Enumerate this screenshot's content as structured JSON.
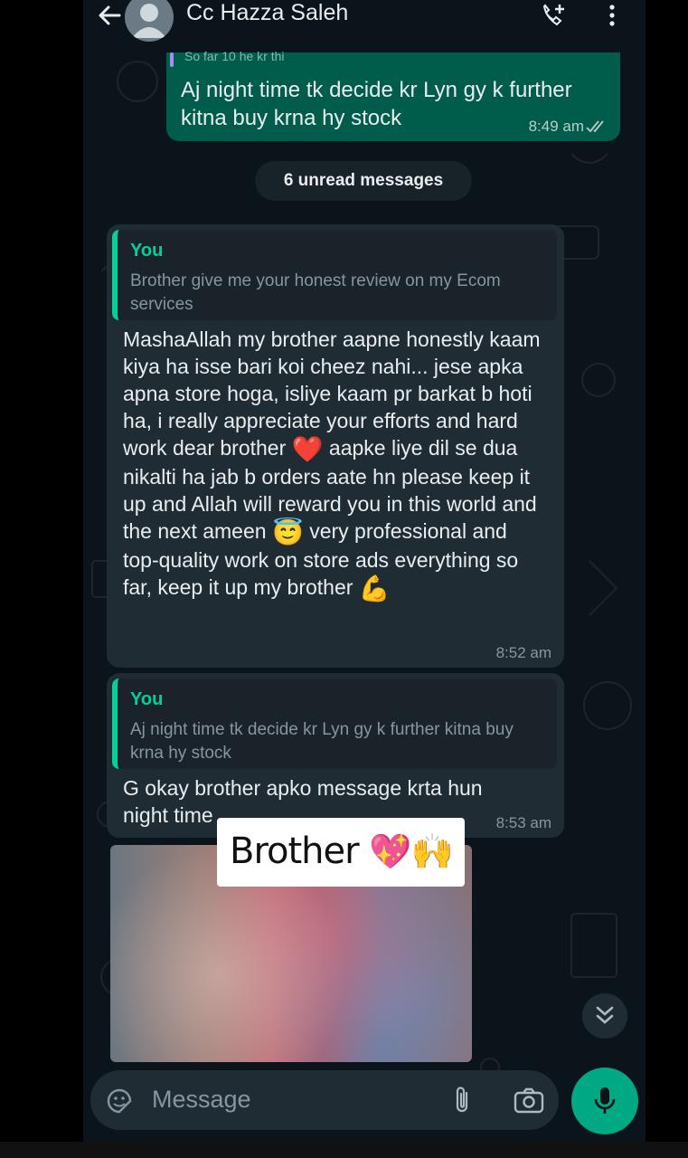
{
  "header": {
    "contact_name": "Cc Hazza Saleh"
  },
  "outgoing_message": {
    "quote_peek": "So far 10 he kr thi",
    "text": "Aj night time tk decide kr Lyn gy k further kitna buy krna hy stock",
    "time": "8:49 am",
    "status": "read"
  },
  "unread_banner": "6 unread messages",
  "incoming_messages": [
    {
      "quote_author": "You",
      "quote_text": "Brother give me your honest review on my Ecom services",
      "text_parts": [
        "MashaAllah my brother aapne honestly kaam kiya ha isse bari koi cheez nahi... jese apka apna store hoga, isliye kaam pr barkat b hoti ha, i really appreciate your efforts and hard work dear brother",
        "aapke liye dil se dua nikalti ha jab b orders aate hn please keep it up and Allah will reward you in this world and the next ameen",
        "very professional and top-quality work on store ads everything so far, keep it up my brother"
      ],
      "emojis": [
        "❤️",
        "😇",
        "💪"
      ],
      "time": "8:52 am"
    },
    {
      "quote_author": "You",
      "quote_text": "Aj night time tk decide kr Lyn gy k further kitna buy krna hy stock",
      "text": "G okay brother apko message krta hun night time",
      "time": "8:53 am"
    }
  ],
  "sticker_overlay": {
    "text": "Brother",
    "emojis": "💖🙌"
  },
  "input": {
    "placeholder": "Message"
  },
  "icons": {
    "back": "arrow-left-icon",
    "call": "add-call-icon",
    "menu": "more-vertical-icon",
    "sticker": "sticker-icon",
    "attach": "paperclip-icon",
    "camera": "camera-icon",
    "mic": "microphone-icon",
    "scroll": "double-chevron-down-icon"
  },
  "colors": {
    "outgoing_bubble": "#005c4b",
    "incoming_bubble": "#202c33",
    "accent": "#00a884",
    "quote_bar": "#06cf9c",
    "background": "#0b141a"
  }
}
